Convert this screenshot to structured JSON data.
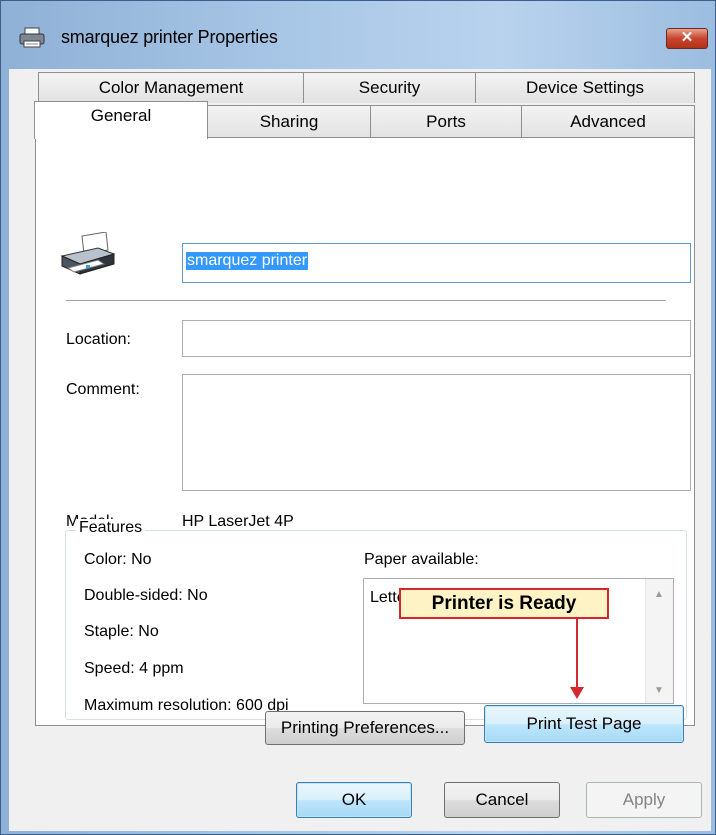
{
  "window": {
    "title": "smarquez printer Properties",
    "close_glyph": "✕"
  },
  "tabs": {
    "row1": [
      "Color Management",
      "Security",
      "Device Settings"
    ],
    "row2": [
      "General",
      "Sharing",
      "Ports",
      "Advanced"
    ],
    "active": "General"
  },
  "general": {
    "printer_name": "smarquez printer",
    "location_label": "Location:",
    "location_value": "",
    "comment_label": "Comment:",
    "comment_value": "",
    "model_label": "Model:",
    "model_value": "HP LaserJet 4P"
  },
  "features": {
    "title": "Features",
    "color": "Color: No",
    "double_sided": "Double-sided: No",
    "staple": "Staple: No",
    "speed": "Speed: 4 ppm",
    "max_resolution": "Maximum resolution: 600 dpi",
    "paper_label": "Paper available:",
    "paper_options": [
      "Letter"
    ]
  },
  "buttons": {
    "printing_preferences": "Printing Preferences...",
    "print_test_page": "Print Test Page",
    "ok": "OK",
    "cancel": "Cancel",
    "apply": "Apply"
  },
  "annotation": {
    "callout": "Printer is Ready",
    "color": "#d2282e"
  },
  "icons": {
    "title_icon": "printer-icon",
    "printer_image": "printer-icon",
    "close": "close-icon"
  }
}
